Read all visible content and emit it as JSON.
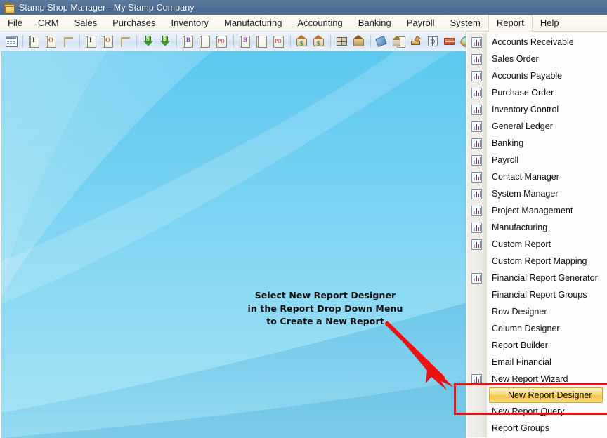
{
  "window": {
    "title": "Stamp Shop Manager - My Stamp Company",
    "icon": "stamp-folder-icon"
  },
  "menubar": {
    "items": [
      {
        "label": "File",
        "accel": "F",
        "open": false
      },
      {
        "label": "CRM",
        "accel": "C",
        "open": false
      },
      {
        "label": "Sales",
        "accel": "S",
        "open": false
      },
      {
        "label": "Purchases",
        "accel": "P",
        "open": false
      },
      {
        "label": "Inventory",
        "accel": "I",
        "open": false
      },
      {
        "label": "Manufacturing",
        "accel": "n",
        "open": false
      },
      {
        "label": "Accounting",
        "accel": "A",
        "open": false
      },
      {
        "label": "Banking",
        "accel": "B",
        "open": false
      },
      {
        "label": "Payroll",
        "accel": "y",
        "open": false
      },
      {
        "label": "System",
        "accel": "m",
        "open": false
      },
      {
        "label": "Report",
        "accel": "R",
        "open": true
      },
      {
        "label": "Help",
        "accel": "H",
        "open": false
      }
    ]
  },
  "toolbar": {
    "buttons": [
      {
        "name": "calendar-icon"
      },
      {
        "sep": true
      },
      {
        "name": "new-invoice-icon"
      },
      {
        "name": "new-order-icon"
      },
      {
        "name": "new-quote-icon"
      },
      {
        "sep": true
      },
      {
        "name": "invoice-icon"
      },
      {
        "name": "order-icon"
      },
      {
        "name": "quote-icon"
      },
      {
        "sep": true
      },
      {
        "name": "receive-payment-icon"
      },
      {
        "name": "make-payment-icon"
      },
      {
        "sep": true
      },
      {
        "name": "bill-entry-icon"
      },
      {
        "name": "blank-document-icon"
      },
      {
        "name": "purchase-order-icon"
      },
      {
        "sep": true
      },
      {
        "name": "bill-icon"
      },
      {
        "name": "document-icon"
      },
      {
        "name": "po-icon"
      },
      {
        "sep": true
      },
      {
        "name": "deposit-icon"
      },
      {
        "name": "withdrawal-icon"
      },
      {
        "sep": true
      },
      {
        "name": "inventory-cube-icon"
      },
      {
        "name": "warehouse-icon"
      },
      {
        "sep": true
      },
      {
        "name": "price-tag-icon"
      },
      {
        "name": "building-document-icon"
      },
      {
        "name": "paint-brush-icon"
      },
      {
        "name": "settings-target-icon"
      },
      {
        "name": "credit-card-icon"
      },
      {
        "name": "globe-refresh-icon"
      }
    ]
  },
  "report_menu": {
    "items": [
      {
        "label": "Accounts Receivable",
        "icon": "chart-icon",
        "accel": ""
      },
      {
        "label": "Sales Order",
        "icon": "chart-icon",
        "accel": ""
      },
      {
        "label": "Accounts Payable",
        "icon": "chart-icon",
        "accel": ""
      },
      {
        "label": "Purchase Order",
        "icon": "chart-icon",
        "accel": ""
      },
      {
        "label": "Inventory Control",
        "icon": "chart-icon",
        "accel": ""
      },
      {
        "label": "General Ledger",
        "icon": "chart-icon",
        "accel": ""
      },
      {
        "label": "Banking",
        "icon": "chart-icon",
        "accel": ""
      },
      {
        "label": "Payroll",
        "icon": "chart-icon",
        "accel": ""
      },
      {
        "label": "Contact Manager",
        "icon": "chart-icon",
        "accel": ""
      },
      {
        "label": "System Manager",
        "icon": "chart-icon",
        "accel": ""
      },
      {
        "label": "Project Management",
        "icon": "chart-icon",
        "accel": ""
      },
      {
        "label": "Manufacturing",
        "icon": "chart-icon",
        "accel": ""
      },
      {
        "label": "Custom Report",
        "icon": "chart-icon",
        "accel": ""
      },
      {
        "label": "Custom Report Mapping",
        "icon": "",
        "accel": ""
      },
      {
        "label": "Financial Report Generator",
        "icon": "chart-icon",
        "accel": ""
      },
      {
        "label": "Financial Report Groups",
        "icon": "",
        "accel": ""
      },
      {
        "label": "Row Designer",
        "icon": "",
        "accel": ""
      },
      {
        "label": "Column Designer",
        "icon": "",
        "accel": ""
      },
      {
        "label": "Report Builder",
        "icon": "",
        "accel": ""
      },
      {
        "label": "Email Financial",
        "icon": "",
        "accel": ""
      },
      {
        "label": "New Report Wizard",
        "icon": "chart-icon",
        "accel": "W"
      },
      {
        "label": "New Report Designer",
        "icon": "",
        "accel": "D",
        "highlighted": true
      },
      {
        "label": "New Report Query",
        "icon": "",
        "accel": "Q"
      },
      {
        "label": "Report Groups",
        "icon": "",
        "accel": ""
      }
    ]
  },
  "annotation": {
    "callout_lines": [
      "Select New Report Designer",
      "in the Report Drop Down Menu",
      "to Create a New Report"
    ],
    "arrow": "red-arrow",
    "highlight_box": "red-rectangle",
    "accent_color": "#ee1111",
    "highlight_color": "#f3c64c"
  }
}
